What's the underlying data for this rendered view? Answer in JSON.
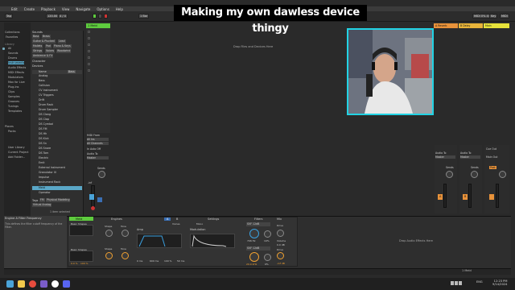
{
  "stream_title": "Making my own dawless device thingy",
  "menu": [
    "Edit",
    "Create",
    "Playback",
    "View",
    "Navigate",
    "Options",
    "Help"
  ],
  "control_bar": {
    "tempo": "120.00",
    "time_sig": "4 / 4",
    "bar": "1 Bar",
    "cpu": "MIDI 0% 4/4",
    "key": "Key",
    "midi": "MIDI"
  },
  "left_rail": {
    "collections": "Collections",
    "favorites": "Favorites",
    "items": [
      "All",
      "Sounds",
      "Drums",
      "Instruments",
      "Audio Effects",
      "MIDI Effects",
      "Modulators",
      "Max for Live",
      "Plug-Ins",
      "Clips",
      "Samples",
      "Grooves",
      "Tunings",
      "Templates"
    ],
    "places_label": "Places",
    "places": [
      "Packs",
      "User Library",
      "Current Project",
      "Add Folder..."
    ]
  },
  "browser": {
    "sounds_label": "Sounds",
    "tags_row1": [
      "Bass",
      "Brass"
    ],
    "tags_row2": [
      "Guitar & Plucked",
      "Lead"
    ],
    "tags_row3": [
      "Mallets",
      "Pad",
      "Piano & Keys"
    ],
    "tags_row4": [
      "Strings",
      "Voices",
      "Woodwind"
    ],
    "tags_row5": [
      "Ambience & FX"
    ],
    "character_label": "Character",
    "devices_label": "Devices",
    "name_header": "Name",
    "filter_value": "Bass",
    "tree": [
      "Analog",
      "Bass",
      "Collision",
      "CV Instrument",
      "CV Triggers",
      "Drift",
      "Drum Rack",
      "Drum Sampler",
      "DS Clang",
      "DS Clap",
      "DS Cymbal",
      "DS FM",
      "DS Hh",
      "DS Kick",
      "DS Sn",
      "DS Snare",
      "DS Tom",
      "Electric",
      "Emit",
      "External Instrument",
      "Granulator III",
      "Impulse",
      "Instrument Rack",
      "Meld",
      "Operator"
    ],
    "selected_index": 23,
    "tags_footer_label": "Tags",
    "footer_tags": [
      "FM",
      "Physical Modeling"
    ],
    "footer_tags2": [
      "Virtual Analog"
    ],
    "result_count": "1 item selected"
  },
  "session": {
    "track_name": "1 Meld",
    "drop_text": "Drop Files and Devices Here",
    "midi_from": "MIDI From",
    "all_ins": "All Ins",
    "all_channels": "All Channels",
    "monitor": "In Auto Off",
    "audio_to": "Audio To",
    "master": "Master",
    "sends": "Sends",
    "volume_readout": "-inf",
    "track_number": "1"
  },
  "right_tracks": [
    {
      "name": "A Reverb",
      "color": "#e8923a"
    },
    {
      "name": "B Delay",
      "color": "#e8b43a"
    },
    {
      "name": "Main",
      "color": "#e6e23a"
    }
  ],
  "right_mixer": {
    "audio_to": "Audio To",
    "master": "Master",
    "cue_out": "Cue Out",
    "main_out": "Main Out",
    "sends": "Sends",
    "post": "Post",
    "track_a": "A",
    "track_b": "B"
  },
  "device_info": {
    "title": "Engine A Filter Frequency",
    "body": "This defines the filter cutoff frequency of the Filter."
  },
  "synth": {
    "name": "Meld",
    "engines_label": "Engines",
    "settings_label": "Settings",
    "filters_label": "Filters",
    "mix_label": "Mix",
    "engine_a": "A",
    "engine_b": "B",
    "osc_a": "Basic Shapes",
    "osc_b": "Basic Shapes",
    "shape_label": "Shape",
    "tone_label": "Tone",
    "amp_label": "Amp",
    "modulation_label": "Modulation",
    "voices_label": "Voices",
    "mono_label": "Mono",
    "filter_type": "SVF 12dB",
    "filter_freq": "706 Hz",
    "filter_res": "19%",
    "filter_freq_b": "20.0 kHz",
    "filter_res_b": "0%",
    "drive_label": "Drive",
    "volume_label": "Volume",
    "volume_a": "0.0 dB",
    "volume_b": "-inf dB",
    "values": [
      "0.0 %",
      "100 %",
      "0.0 %",
      "100 %"
    ],
    "attack": "0 ms",
    "decay": "600 ms",
    "sustain": "100 %",
    "release": "50 ms"
  },
  "effects_drop": "Drop Audio Effects Here",
  "status_right": "1 Meld",
  "taskbar": {
    "lang": "ENG",
    "time": "12:23 PM",
    "date": "9/14/2024"
  },
  "colors": {
    "accent_green": "#5ecb3e",
    "selection_blue": "#5aa7c7",
    "cam_border": "#22d3e4",
    "title_bg": "#000000"
  }
}
